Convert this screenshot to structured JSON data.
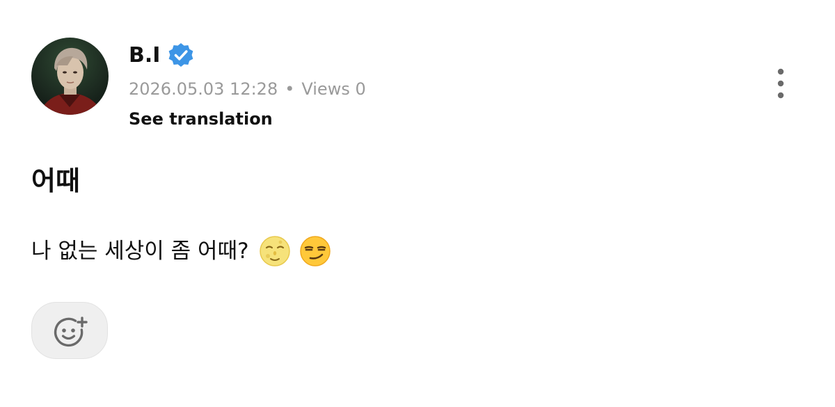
{
  "post": {
    "author": {
      "name": "B.I",
      "verified": true,
      "avatar_icon": "avatar"
    },
    "date": "2026.05.03 12:28",
    "separator": "•",
    "views": "Views 0",
    "see_translation": "See translation",
    "more_icon": "more-vertical-icon",
    "title": "어때",
    "body": "나 없는 세상이 좀 어때?",
    "emojis": [
      "full-moon-face-emoji",
      "smirking-face-emoji"
    ],
    "reaction_icon": "add-reaction-icon"
  },
  "colors": {
    "verified": "#3d95e6",
    "meta_text": "#9a9a9a",
    "reaction_bg": "#efefef",
    "icon_gray": "#6a6a6a"
  }
}
